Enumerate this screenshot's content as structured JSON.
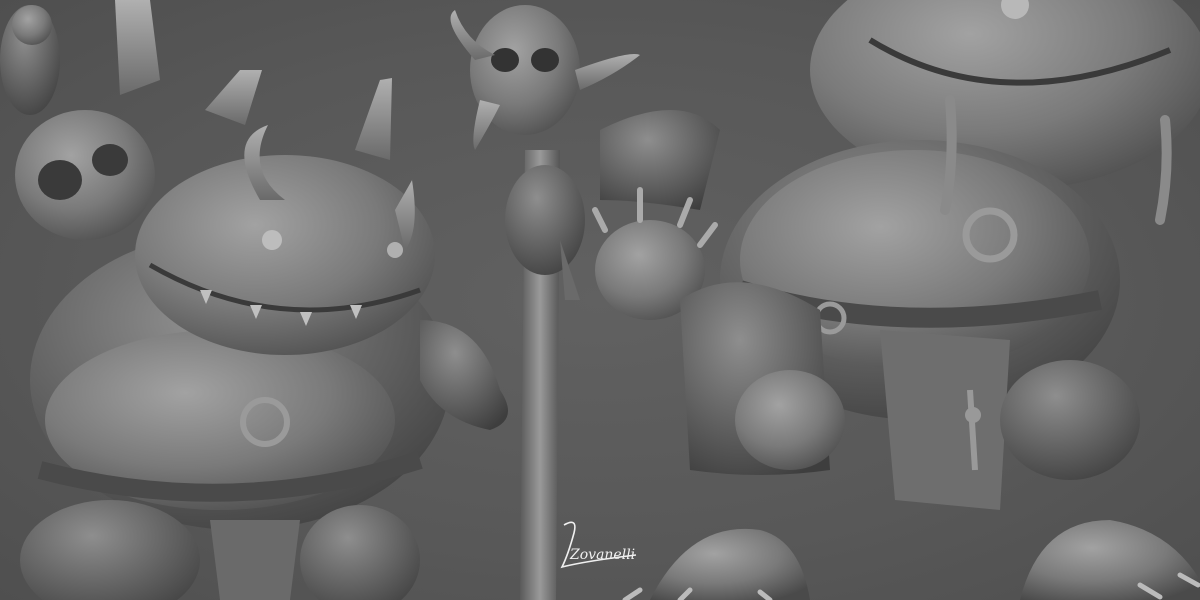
{
  "image": {
    "description_kind": "3d-sculpt-render",
    "background_color": "#5a5a5a",
    "material_color": "#8a8a8a"
  },
  "signature": {
    "text": "Zovanelli"
  }
}
